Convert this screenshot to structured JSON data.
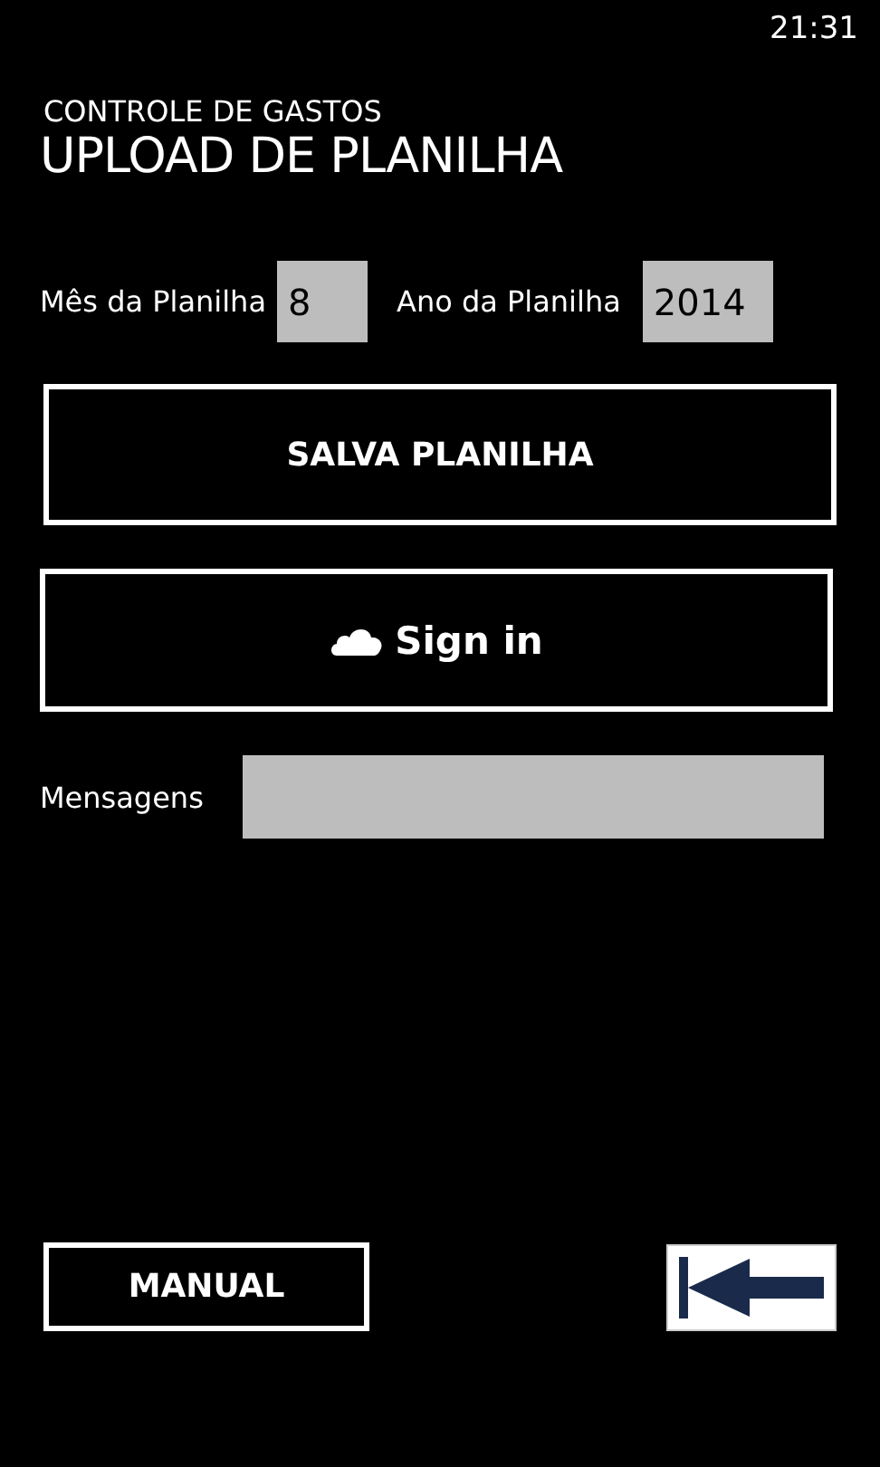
{
  "status_bar": {
    "time": "21:31"
  },
  "app_title": "CONTROLE DE GASTOS",
  "page_title": "UPLOAD DE PLANILHA",
  "fields": [
    {
      "label": "Mês da Planilha",
      "value": "8"
    },
    {
      "label": "Ano da Planilha",
      "value": "2014"
    }
  ],
  "save_button": "SALVA PLANILHA",
  "sign_in_button": "Sign in",
  "messages": {
    "label": "Mensagens"
  },
  "manual_button": "MANUAL"
}
